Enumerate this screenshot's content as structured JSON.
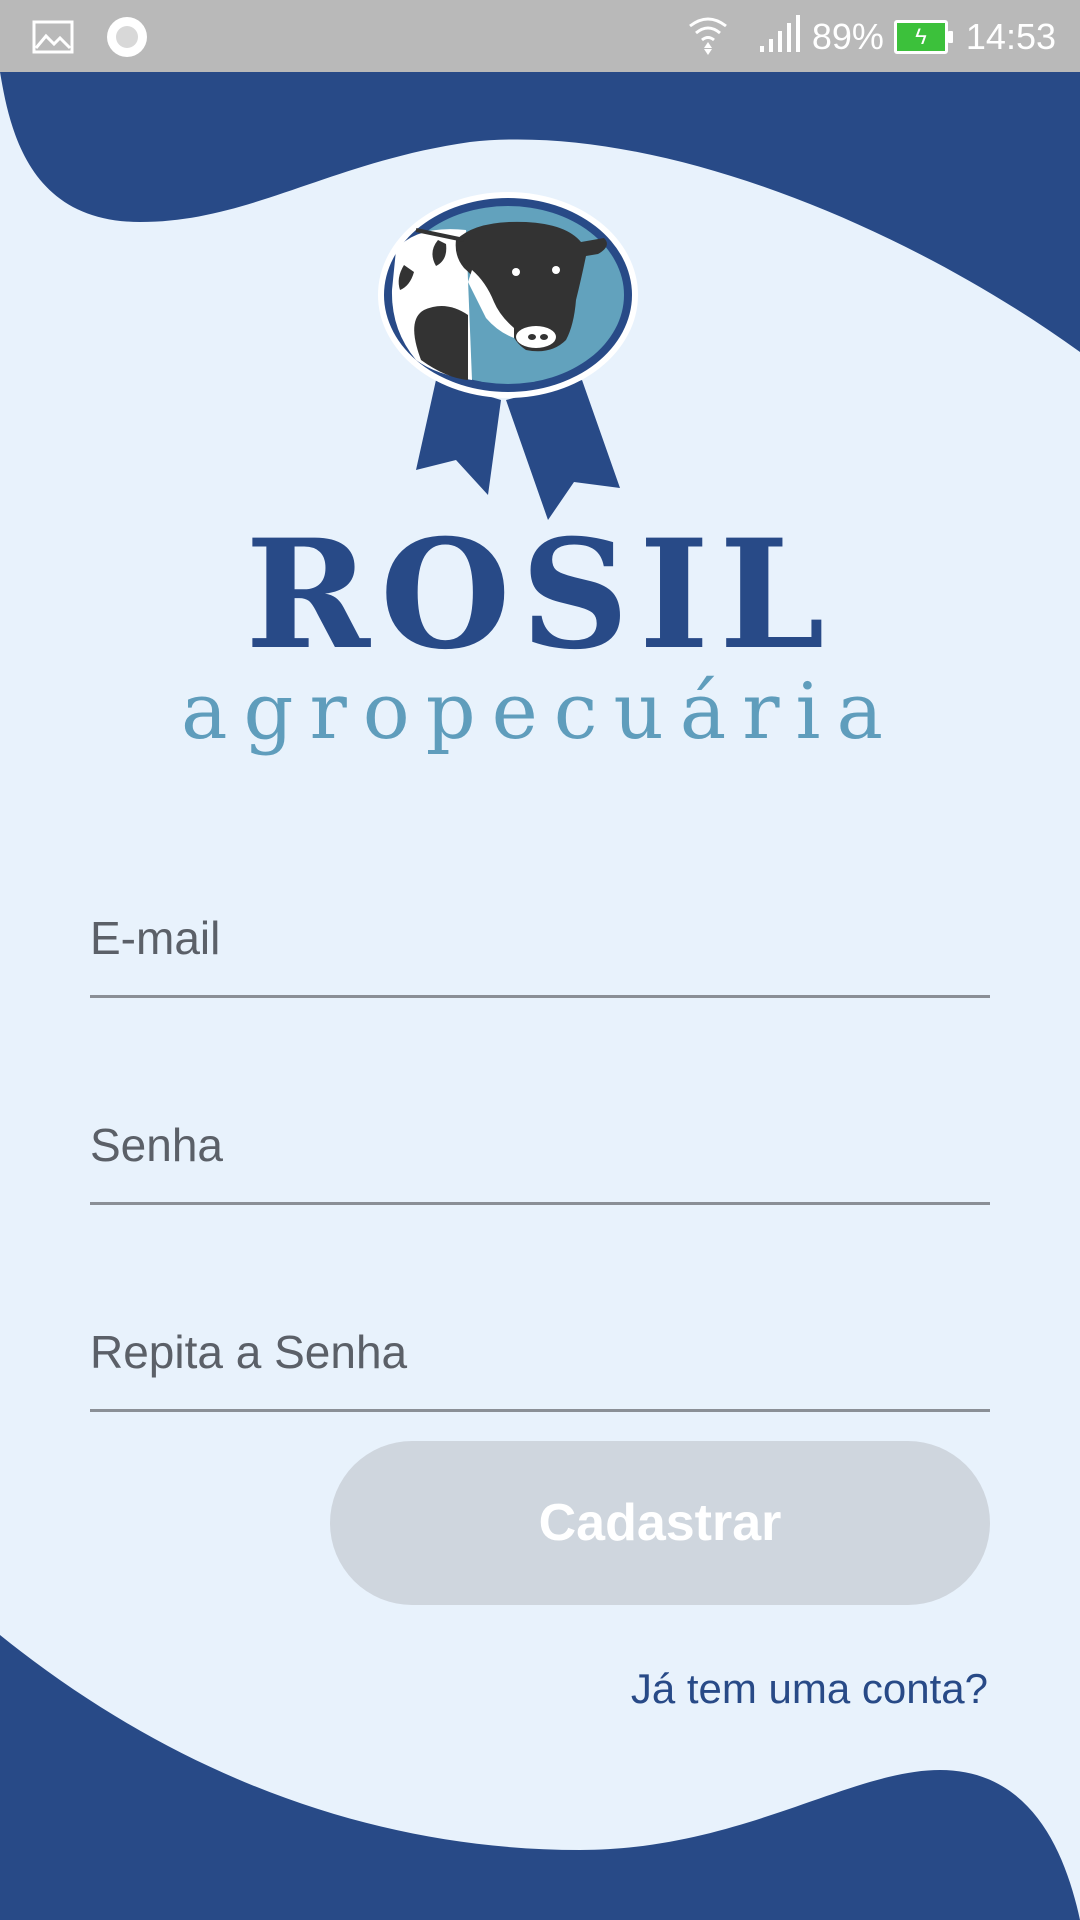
{
  "status_bar": {
    "left_icons": [
      "image-icon",
      "circle-notification-icon"
    ],
    "battery_percent": "89%",
    "time": "14:53",
    "battery_level": 0.89,
    "battery_color": "#3cc13b"
  },
  "brand": {
    "name": "ROSIL",
    "subtitle": "agropecuária",
    "primary_color": "#284a87",
    "secondary_color": "#5f9dbc"
  },
  "form": {
    "email_placeholder": "E-mail",
    "password_placeholder": "Senha",
    "repeat_password_placeholder": "Repita a Senha"
  },
  "actions": {
    "submit_label": "Cadastrar",
    "login_link_label": "Já tem uma conta?"
  }
}
